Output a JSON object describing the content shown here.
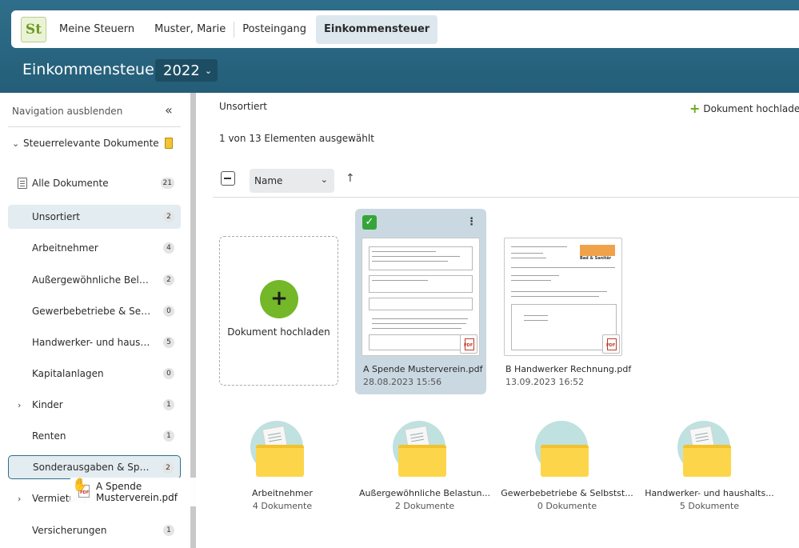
{
  "header": {
    "logo_text": "St",
    "nav": [
      "Meine Steuern",
      "Muster, Marie",
      "Posteingang",
      "Einkommensteuer"
    ],
    "page_title": "Einkommensteuer",
    "year": "2022"
  },
  "sidebar": {
    "hide_label": "Navigation ausblenden",
    "group_label": "Steuerrelevante Dokumente",
    "items": [
      {
        "label": "Alle Dokumente",
        "count": "21"
      },
      {
        "label": "Unsortiert",
        "count": "2"
      },
      {
        "label": "Arbeitnehmer",
        "count": "4"
      },
      {
        "label": "Außergewöhnliche Belast...",
        "count": "2"
      },
      {
        "label": "Gewerbebetriebe & Selbst...",
        "count": "0"
      },
      {
        "label": "Handwerker- und haushal...",
        "count": "5"
      },
      {
        "label": "Kapitalanlagen",
        "count": "0"
      },
      {
        "label": "Kinder",
        "count": "1"
      },
      {
        "label": "Renten",
        "count": "1"
      },
      {
        "label": "Sonderausgaben & Spend...",
        "count": "2"
      },
      {
        "label": "Vermietung",
        "count": ""
      },
      {
        "label": "Versicherungen",
        "count": "1"
      }
    ]
  },
  "drag": {
    "filename": "A Spende Musterverein.pdf"
  },
  "main": {
    "title": "Unsortiert",
    "upload_link": "Dokument hochladen",
    "selection": "1 von 13 Elementen ausgewählt",
    "sort_by": "Name",
    "upload_card_label": "Dokument hochladen",
    "documents": [
      {
        "name": "A Spende Musterverein.pdf",
        "date": "28.08.2023 15:56",
        "selected": true
      },
      {
        "name": "B Handwerker Rechnung.pdf",
        "date": "13.09.2023 16:52",
        "selected": false,
        "thumb_heading": "Bad & Sanitär"
      }
    ],
    "folders": [
      {
        "name": "Arbeitnehmer",
        "count": "4 Dokumente"
      },
      {
        "name": "Außergewöhnliche Belastun...",
        "count": "2 Dokumente"
      },
      {
        "name": "Gewerbebetriebe & Selbstst...",
        "count": "0 Dokumente"
      },
      {
        "name": "Handwerker- und haushalts...",
        "count": "5 Dokumente"
      }
    ]
  }
}
